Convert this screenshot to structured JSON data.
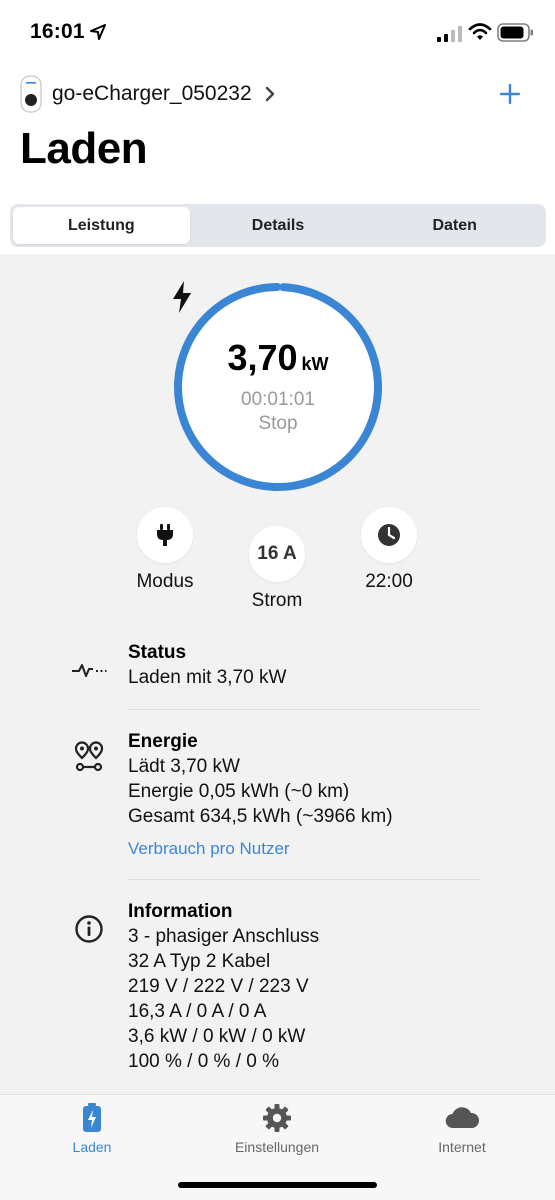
{
  "status_bar": {
    "time": "16:01"
  },
  "header": {
    "device_name": "go-eCharger_050232",
    "add_label": "+"
  },
  "page": {
    "title": "Laden"
  },
  "tabs": [
    {
      "label": "Leistung",
      "active": true
    },
    {
      "label": "Details",
      "active": false
    },
    {
      "label": "Daten",
      "active": false
    }
  ],
  "charging": {
    "power_value": "3,70",
    "power_unit": "kW",
    "elapsed": "00:01:01",
    "action": "Stop",
    "ring_progress": 0.99,
    "ring_color": "#3b86d4"
  },
  "controls": {
    "mode_label": "Modus",
    "current_value": "16 A",
    "current_label": "Strom",
    "timer_label": "22:00"
  },
  "status_section": {
    "title": "Status",
    "lines": [
      "Laden mit 3,70 kW"
    ]
  },
  "energy_section": {
    "title": "Energie",
    "lines": [
      "Lädt 3,70 kW",
      "Energie 0,05 kWh (~0 km)",
      "Gesamt 634,5 kWh (~3966 km)"
    ],
    "link": "Verbrauch pro Nutzer"
  },
  "info_section": {
    "title": "Information",
    "lines": [
      "3 - phasiger Anschluss",
      "32 A Typ 2 Kabel",
      "219 V / 222 V / 223 V",
      "16,3 A / 0 A / 0 A",
      "3,6 kW / 0 kW / 0 kW",
      "100 % / 0 % / 0 %"
    ]
  },
  "tabbar": [
    {
      "label": "Laden",
      "icon": "battery-charging-icon",
      "active": true
    },
    {
      "label": "Einstellungen",
      "icon": "gear-icon",
      "active": false
    },
    {
      "label": "Internet",
      "icon": "cloud-icon",
      "active": false
    }
  ],
  "colors": {
    "accent": "#3b86d4",
    "background": "#f2f2f2"
  }
}
